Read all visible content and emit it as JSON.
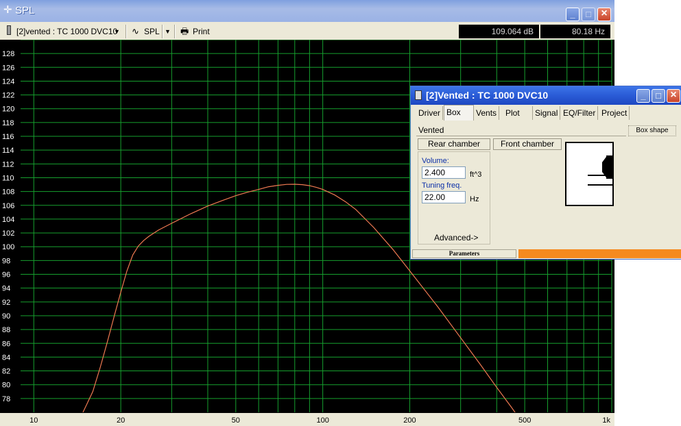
{
  "spl_window": {
    "title": "SPL",
    "title_icon": "crosshair-icon",
    "buttons": [
      "minimize",
      "maximize",
      "close"
    ]
  },
  "toolbar": {
    "driver_select": "[2]vented : TC 1000 DVC10",
    "plot_select": "SPL",
    "print_label": "Print",
    "spl_readout": "109.064 dB",
    "freq_readout": "80.18 Hz"
  },
  "chart_data": {
    "type": "line",
    "title": "",
    "xlabel": "",
    "ylabel": "",
    "x_scale": "log",
    "xlim": [
      9,
      1000
    ],
    "ylim": [
      76,
      130
    ],
    "x_tick_labels": [
      "10",
      "20",
      "50",
      "100",
      "200",
      "500",
      "1k"
    ],
    "y_tick_labels": [
      "128",
      "126",
      "124",
      "122",
      "120",
      "118",
      "116",
      "114",
      "112",
      "110",
      "108",
      "106",
      "104",
      "102",
      "100",
      "98",
      "96",
      "94",
      "92",
      "90",
      "88",
      "86",
      "84",
      "82",
      "80",
      "78"
    ],
    "grid": true,
    "background": "#000000",
    "grid_color": "#16a02e",
    "line_color": "#f07a52",
    "series": [
      {
        "x": [
          14.8,
          16,
          17,
          18,
          19,
          20,
          21,
          22,
          23,
          24,
          25,
          27,
          30,
          35,
          40,
          45,
          50,
          55,
          60,
          65,
          70,
          75,
          80,
          85,
          90,
          95,
          100,
          110,
          120,
          130,
          150,
          175,
          200,
          250,
          300,
          350,
          400,
          450,
          500
        ],
        "y": [
          76.0,
          79.0,
          82.6,
          86.3,
          90.0,
          93.4,
          96.5,
          98.8,
          100.1,
          100.9,
          101.5,
          102.4,
          103.4,
          104.8,
          105.9,
          106.7,
          107.4,
          107.9,
          108.3,
          108.7,
          108.9,
          109.04,
          109.06,
          109.0,
          108.85,
          108.6,
          108.3,
          107.5,
          106.5,
          105.4,
          102.8,
          99.6,
          96.5,
          91.3,
          86.8,
          83.0,
          79.6,
          76.7,
          74.0
        ]
      }
    ]
  },
  "vented_window": {
    "title": "[2]Vented : TC 1000 DVC10",
    "tabs": [
      "Driver",
      "Box",
      "Vents",
      "Plot",
      "Signal",
      "EQ/Filter",
      "Project"
    ],
    "active_tab": "Box",
    "box_type": "Vented",
    "box_shape_button": "Box shape",
    "rear_chamber_button": "Rear chamber",
    "front_chamber_button": "Front chamber",
    "volume_label": "Volume:",
    "volume_value": "2.400",
    "volume_unit": "ft^3",
    "tuning_label": "Tuning freq.",
    "tuning_value": "22.00",
    "tuning_unit": "Hz",
    "advanced_button": "Advanced->",
    "status_label": "Parameters",
    "progress": 1.0,
    "progress_color": "#f58a1f"
  }
}
